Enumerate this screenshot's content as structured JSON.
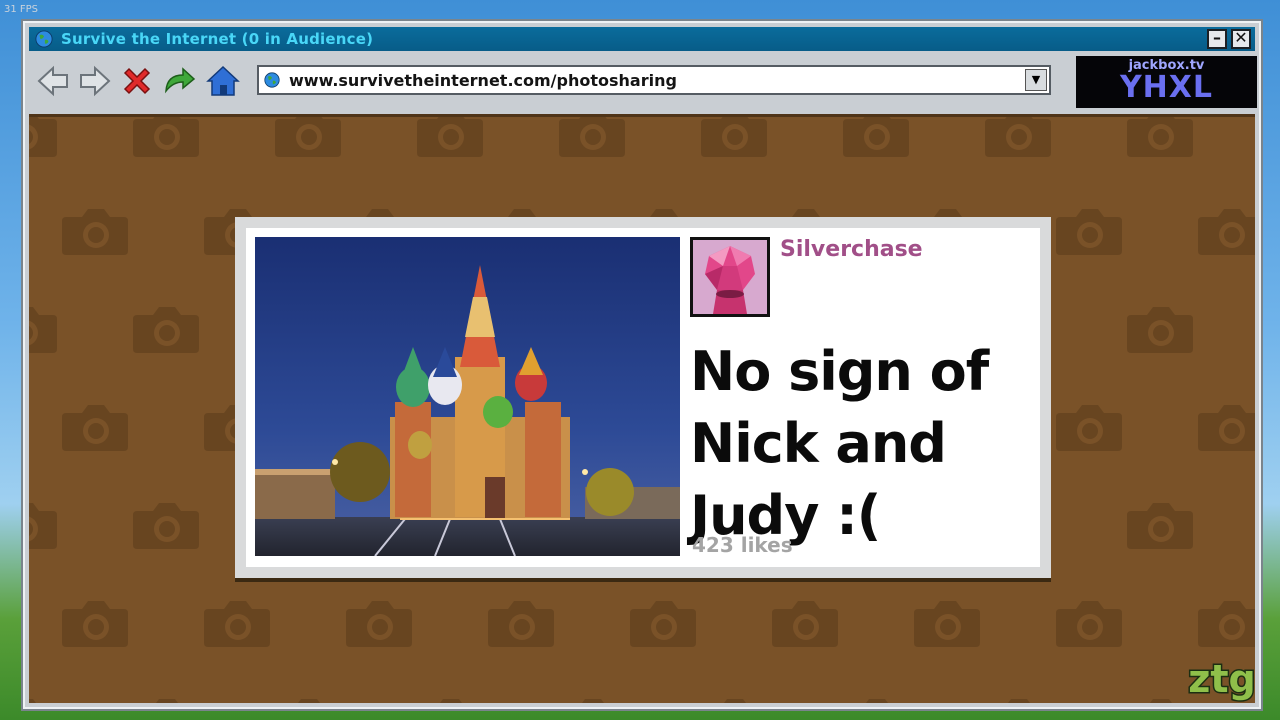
{
  "overlay": {
    "fps": "31 FPS"
  },
  "window": {
    "title": "Survive the Internet  (0 in Audience)",
    "minimize_label": "–",
    "close_label": "✕"
  },
  "toolbar": {
    "icons": [
      "back-arrow-icon",
      "forward-arrow-icon",
      "stop-x-icon",
      "refresh-icon",
      "home-icon"
    ],
    "url": "www.survivetheinternet.com/photosharing"
  },
  "room": {
    "site": "jackbox.tv",
    "code": "YHXL"
  },
  "post": {
    "username": "Silverchase",
    "caption": "No sign of Nick and Judy :(",
    "likes": "423 likes",
    "photo_subject": "cathedral-at-night-image"
  },
  "watermark": {
    "text": "ztg"
  },
  "colors": {
    "titlebar": "#075c88",
    "title_text": "#49d7f7",
    "content_bg": "#7a5228",
    "username": "#a14f88",
    "room_code": "#6a6ff0",
    "avatar_bg": "#d7a9cf"
  }
}
